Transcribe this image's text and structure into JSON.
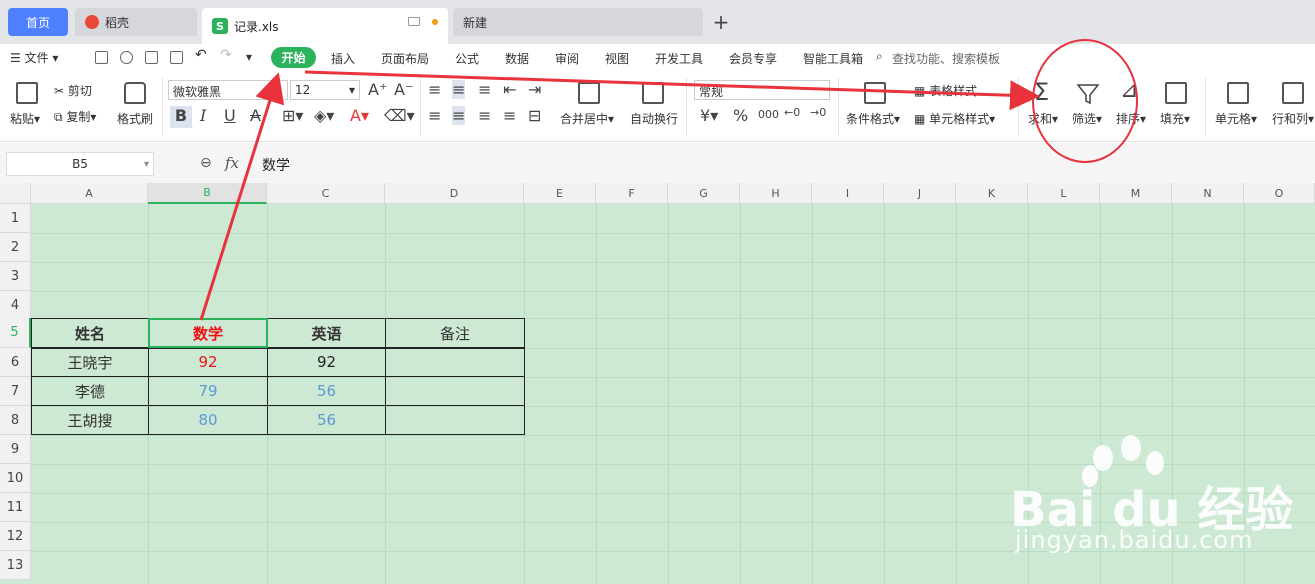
{
  "tabs": {
    "home": "首页",
    "daoke": "稻壳",
    "file": "记录.xls",
    "new": "新建",
    "add": "+"
  },
  "menu": {
    "file": "文件",
    "items": [
      "开始",
      "插入",
      "页面布局",
      "公式",
      "数据",
      "审阅",
      "视图",
      "开发工具",
      "会员专享",
      "智能工具箱"
    ],
    "search": "查找功能、搜索模板"
  },
  "ribbon": {
    "paste": "粘贴",
    "cut": "剪切",
    "copy": "复制",
    "format_painter": "格式刷",
    "font": "微软雅黑",
    "size": "12",
    "merge_center": "合并居中",
    "wrap": "自动换行",
    "number_format": "常规",
    "currency": "¥",
    "percent": "%",
    "thousands": "000",
    "conditional": "条件格式",
    "table_style": "表格样式",
    "cell_style": "单元格样式",
    "sum": "求和",
    "filter": "筛选",
    "sort": "排序",
    "fill": "填充",
    "cell": "单元格",
    "rowcol": "行和列"
  },
  "formula_bar": {
    "name_box": "B5",
    "fx": "fx",
    "content": "数学"
  },
  "columns": [
    "A",
    "B",
    "C",
    "D",
    "E",
    "F",
    "G",
    "H",
    "I",
    "J",
    "K",
    "L",
    "M",
    "N",
    "O"
  ],
  "rows": [
    "1",
    "2",
    "3",
    "4",
    "5",
    "6",
    "7",
    "8",
    "9",
    "10",
    "11",
    "12",
    "13"
  ],
  "table": {
    "headers": [
      "姓名",
      "数学",
      "英语",
      "备注"
    ],
    "rows": [
      [
        "王晓宇",
        "92",
        "92",
        ""
      ],
      [
        "李德",
        "79",
        "56",
        ""
      ],
      [
        "王胡搜",
        "80",
        "56",
        ""
      ]
    ]
  },
  "colors": {
    "accent": "#2bb35c",
    "sheet_bg": "#cde8d3",
    "header_red": "#ee1111",
    "value_blue": "#5b9bd5",
    "annotation_red": "#e8323c"
  },
  "watermark": {
    "logo": "Bai du 经验",
    "url": "jingyan.baidu.com"
  }
}
